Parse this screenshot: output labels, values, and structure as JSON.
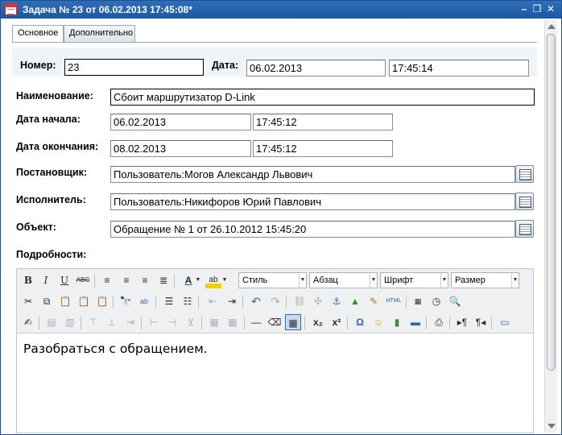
{
  "window": {
    "title": "Задача № 23 от 06.02.2013 17:45:08*",
    "controls": [
      "–",
      "❐",
      "✕"
    ]
  },
  "tabs": [
    {
      "label": "Основное",
      "active": true
    },
    {
      "label": "Дополнительно",
      "active": false
    }
  ],
  "form": {
    "number_label": "Номер:",
    "number_value": "23",
    "date_label": "Дата:",
    "date_value": "06.02.2013",
    "time_value": "17:45:14",
    "name_label": "Наименование:",
    "name_value": "Сбоит маршрутизатор D-Link",
    "start_label": "Дата начала:",
    "start_date": "06.02.2013",
    "start_time": "17:45:12",
    "end_label": "Дата окончания:",
    "end_date": "08.02.2013",
    "end_time": "17:45:12",
    "author_label": "Постановщик:",
    "author_value": "Пользователь:Могов Александр Львович",
    "assignee_label": "Исполнитель:",
    "assignee_value": "Пользователь:Никифоров Юрий Павлович",
    "object_label": "Объект:",
    "object_value": "Обращение № 1 от 26.10.2012 15:45:20",
    "details_label": "Подробности:"
  },
  "editor": {
    "style_combo": "Стиль",
    "paragraph_combo": "Абзац",
    "font_combo": "Шрифт",
    "size_combo": "Размер",
    "body_text": "Разобраться с обращением.",
    "html_button": "HTML"
  },
  "colors": {
    "titlebar": "#1c57a0",
    "panel": "#eef4f8"
  }
}
